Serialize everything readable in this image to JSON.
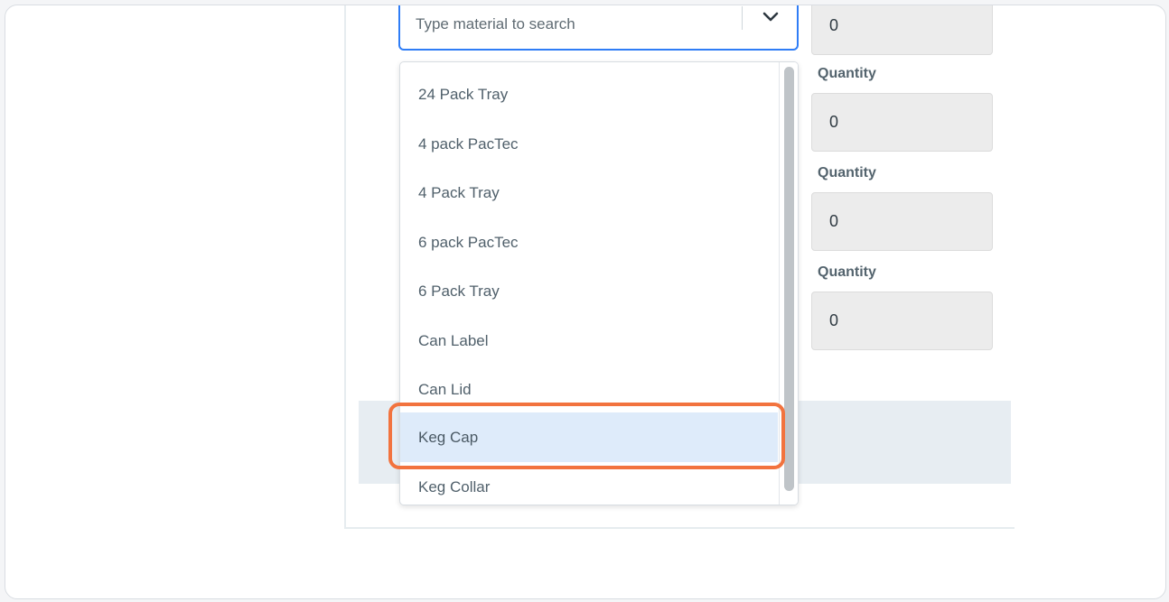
{
  "search": {
    "placeholder": "Type material to search",
    "value": ""
  },
  "dropdown": {
    "options": [
      "24 Pack Tray",
      "4 pack PacTec",
      "4 Pack Tray",
      "6 pack PacTec",
      "6 Pack Tray",
      "Can Label",
      "Can Lid",
      "Keg Cap",
      "Keg Collar"
    ],
    "highlighted": "Keg Cap"
  },
  "quantities": {
    "label": "Quantity",
    "values": [
      "0",
      "0",
      "0",
      "0"
    ]
  },
  "colors": {
    "focus_border": "#2f7df6",
    "highlight_ring": "#f2733e",
    "highlight_bg": "#deebfa"
  },
  "icons": {
    "dropdown_toggle": "chevron-down-icon"
  }
}
